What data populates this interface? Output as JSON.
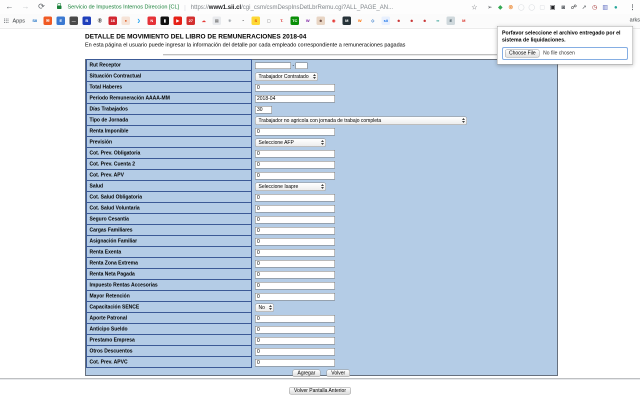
{
  "browser": {
    "back_glyph": "←",
    "forward_glyph": "→",
    "reload_glyph": "⟳",
    "security_label": "Servicio de Impuestos Internos Direccion [CL]",
    "url_sep": "|",
    "url_scheme": "https://",
    "url_domain": "www1.sii.cl",
    "url_path": "/cgi_csm/csmDespInsDetLbrRemu.cgi?ALL_PAGE_AN...",
    "star_glyph": "☆",
    "menu_glyph": "⋮",
    "extensions": [
      {
        "glyph": "➢",
        "fg": "#5f6368"
      },
      {
        "glyph": "◆",
        "fg": "#34a853"
      },
      {
        "glyph": "⊗",
        "fg": "#e8710a"
      },
      {
        "glyph": "◯",
        "fg": "#d5d8dc"
      },
      {
        "glyph": "◯",
        "fg": "#d5d8dc"
      },
      {
        "glyph": "▢",
        "fg": "#d5d8dc"
      },
      {
        "glyph": "▣",
        "fg": "#202124"
      },
      {
        "glyph": "◙",
        "fg": "#5f6368"
      },
      {
        "glyph": "☍",
        "fg": "#202124"
      },
      {
        "glyph": "➚",
        "fg": "#5f6368"
      },
      {
        "glyph": "◷",
        "fg": "#a23333"
      },
      {
        "glyph": "▥",
        "fg": "#5c6bc0"
      },
      {
        "glyph": "●",
        "fg": "#26a69a"
      }
    ],
    "apps_label": "Apps",
    "bookmarks": [
      {
        "glyph": "SII",
        "bg": "transparent",
        "fg": "#1a6fc4"
      },
      {
        "glyph": "✉",
        "bg": "#f05a23",
        "fg": "#ffffff"
      },
      {
        "glyph": "E",
        "bg": "#3b79d1",
        "fg": "#ffffff"
      },
      {
        "glyph": "—",
        "bg": "#4a4a4a",
        "fg": "#ffffff"
      },
      {
        "glyph": "B",
        "bg": "#1f3fbb",
        "fg": "#ffffff"
      },
      {
        "glyph": "Ⓑ",
        "bg": "transparent",
        "fg": "#222222"
      },
      {
        "glyph": "16",
        "bg": "#d22630",
        "fg": "#ffffff"
      },
      {
        "glyph": "●",
        "bg": "#f6e3d7",
        "fg": "#e0622d"
      },
      {
        "glyph": "❯",
        "bg": "transparent",
        "fg": "#1da1f2"
      },
      {
        "glyph": "N",
        "bg": "#e53238",
        "fg": "#ffffff"
      },
      {
        "glyph": "▮",
        "bg": "#111111",
        "fg": "#ffffff"
      },
      {
        "glyph": "▶",
        "bg": "#e62117",
        "fg": "#ffffff"
      },
      {
        "glyph": "27",
        "bg": "#d32f2f",
        "fg": "#ffffff"
      },
      {
        "glyph": "☁",
        "bg": "transparent",
        "fg": "#e53935"
      },
      {
        "glyph": "▤",
        "bg": "#e8eaed",
        "fg": "#777777"
      },
      {
        "glyph": "✳",
        "bg": "transparent",
        "fg": "#9aa0a6"
      },
      {
        "glyph": "◔",
        "bg": "transparent",
        "fg": "#111111"
      },
      {
        "glyph": "S",
        "bg": "#fdd835",
        "fg": "#e65100"
      },
      {
        "glyph": "▢",
        "bg": "transparent",
        "fg": "#9e9e9e"
      },
      {
        "glyph": "T.",
        "bg": "transparent",
        "fg": "#d81b1b"
      },
      {
        "glyph": "TC",
        "bg": "#0a8f08",
        "fg": "#ffffff"
      },
      {
        "glyph": "W",
        "bg": "transparent",
        "fg": "#7b1fa2"
      },
      {
        "glyph": "☻",
        "bg": "#e8d5c4",
        "fg": "#6d4c41"
      },
      {
        "glyph": "◉",
        "bg": "transparent",
        "fg": "#e53935"
      },
      {
        "glyph": "M",
        "bg": "#263238",
        "fg": "#ffffff"
      },
      {
        "glyph": "W",
        "bg": "transparent",
        "fg": "#ff6f00"
      },
      {
        "glyph": "◇",
        "bg": "transparent",
        "fg": "#1565c0"
      },
      {
        "glyph": "sii",
        "bg": "#e8f0fe",
        "fg": "#1a73e8"
      },
      {
        "glyph": "☻",
        "bg": "transparent",
        "fg": "#c62828"
      },
      {
        "glyph": "☻",
        "bg": "transparent",
        "fg": "#c62828"
      },
      {
        "glyph": "☻",
        "bg": "transparent",
        "fg": "#c62828"
      },
      {
        "glyph": "∞",
        "bg": "transparent",
        "fg": "#00897b"
      },
      {
        "glyph": "E",
        "bg": "#cfd8dc",
        "fg": "#455a64"
      },
      {
        "glyph": "M",
        "bg": "transparent",
        "fg": "#d93025"
      }
    ],
    "other_bookmarks_partial": "arks"
  },
  "dialog": {
    "message": "Porfavor seleccione el archivo entregado por el sistema de liquidaciones.",
    "choose_file_label": "Choose File",
    "no_file_text": "No file chosen"
  },
  "page": {
    "title": "DETALLE DE MOVIMIENTO DEL LIBRO DE REMUNERACIONES 2018-04",
    "subtitle": "En esta página el usuario puede ingresar la información del detalle por cada empleado correspondiente a remuneraciones pagadas",
    "form": {
      "rut_dash": "-",
      "rows": [
        {
          "label": "Rut Receptor",
          "type": "rut",
          "value": "",
          "value2": ""
        },
        {
          "label": "Situación Contractual",
          "type": "select-md",
          "value": "Trabajador Contratado"
        },
        {
          "label": "Total Haberes",
          "type": "text",
          "value": "0"
        },
        {
          "label": "Periodo Remuneración AAAA-MM",
          "type": "text",
          "value": "2018-04"
        },
        {
          "label": "Días Trabajados",
          "type": "text-sm",
          "value": "30"
        },
        {
          "label": "Tipo de Jornada",
          "type": "select-xl",
          "value": "Trabajador no agricola con jornada de trabajo completa"
        },
        {
          "label": "Renta Imponible",
          "type": "text",
          "value": "0"
        },
        {
          "label": "Previsión",
          "type": "select-lg",
          "value": "Seleccione AFP"
        },
        {
          "label": "Cot. Prev. Obligatoria",
          "type": "text",
          "value": "0"
        },
        {
          "label": "Cot. Prev. Cuenta 2",
          "type": "text",
          "value": "0"
        },
        {
          "label": "Cot. Prev. APV",
          "type": "text",
          "value": "0"
        },
        {
          "label": "Salud",
          "type": "select-lg",
          "value": "Seleccione Isapre"
        },
        {
          "label": "Cot. Salud Obligatoria",
          "type": "text",
          "value": "0"
        },
        {
          "label": "Cot. Salud Voluntaria",
          "type": "text",
          "value": "0"
        },
        {
          "label": "Seguro Cesantía",
          "type": "text",
          "value": "0"
        },
        {
          "label": "Cargas Familiares",
          "type": "text",
          "value": "0"
        },
        {
          "label": "Asignación Familiar",
          "type": "text",
          "value": "0"
        },
        {
          "label": "Renta Exenta",
          "type": "text",
          "value": "0"
        },
        {
          "label": "Renta Zona Extrema",
          "type": "text",
          "value": "0"
        },
        {
          "label": "Renta Neta Pagada",
          "type": "text",
          "value": "0"
        },
        {
          "label": "Impuesto Rentas Accesorias",
          "type": "text",
          "value": "0"
        },
        {
          "label": "Mayor Retención",
          "type": "text",
          "value": "0"
        },
        {
          "label": "Capacitación SENCE",
          "type": "select-xs",
          "value": "No"
        },
        {
          "label": "Aporte Patronal",
          "type": "text",
          "value": "0"
        },
        {
          "label": "Anticipo Sueldo",
          "type": "text",
          "value": "0"
        },
        {
          "label": "Prestamo Empresa",
          "type": "text",
          "value": "0"
        },
        {
          "label": "Otros Descuentos",
          "type": "text",
          "value": "0"
        },
        {
          "label": "Cot. Prev. APVC",
          "type": "text",
          "value": "0"
        }
      ],
      "agregar_label": "Agregar",
      "volver_label": "Volver"
    },
    "footer_button": "Volver Pantalla Anterior"
  },
  "colors": {
    "form_bg": "#b4cce6",
    "label_border": "#3c5a96",
    "secure_green": "#188038"
  }
}
